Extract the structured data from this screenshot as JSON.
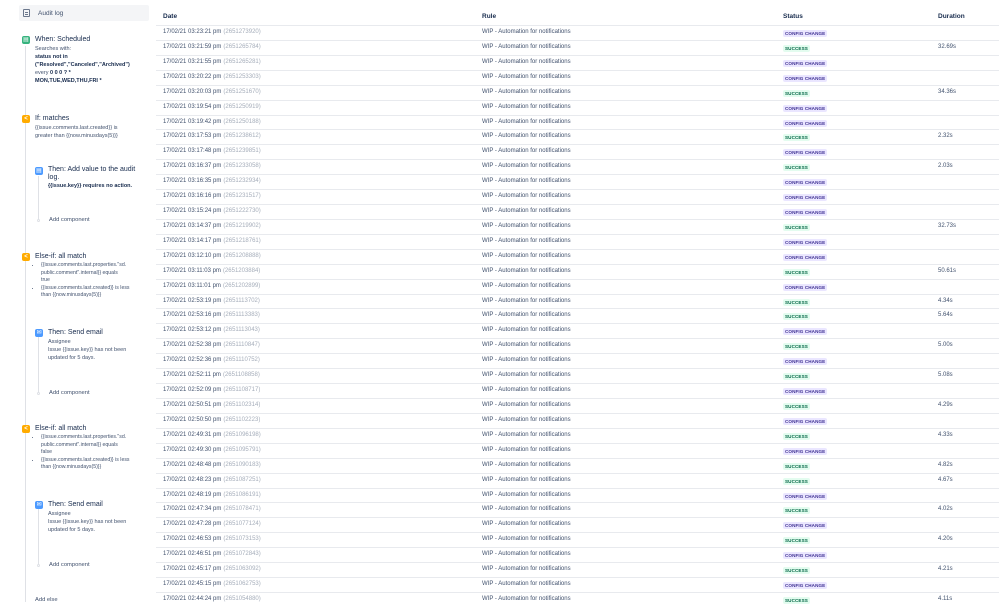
{
  "sidebar": {
    "audit_log_label": "Audit log",
    "trigger": {
      "title": "When: Scheduled",
      "line1": "Searches with:",
      "line2": "status not in",
      "line3": "(\"Resolved\",\"Canceled\",\"Archived\")",
      "line4a": "every ",
      "line4b": "0 0 0 ? *",
      "line5": "MON,TUE,WED,THU,FRI *"
    },
    "if_matches": {
      "title": "If: matches",
      "line1": "{{issue.comments.last.created}} is",
      "line2": "greater than {{now.minusdays(5)}}"
    },
    "action1": {
      "title_line1": "Then: Add value to the audit",
      "title_line2": "log.",
      "detail": "{{issue.key}} requires no action.",
      "add_component": "Add component"
    },
    "else_if_1": {
      "title": "Else-if: all match",
      "b1_l1": "{{issue.comments.last.properties.\"sd.",
      "b1_l2": "public.comment\".internal}} equals",
      "b1_l3": "true",
      "b2_l1": "{{issue.comments.last.created}} is less",
      "b2_l2": "than {{now.minusdays(5)}}"
    },
    "email1": {
      "title": "Then: Send email",
      "line1": "Assignee",
      "line2": "Issue {{issue.key}} has not been",
      "line3": "updated for 5 days.",
      "add_component": "Add component"
    },
    "else_if_2": {
      "title": "Else-if: all match",
      "b1_l1": "{{issue.comments.last.properties.\"sd.",
      "b1_l2": "public.comment\".internal}} equals",
      "b1_l3": "false",
      "b2_l1": "{{issue.comments.last.created}} is less",
      "b2_l2": "than {{now.minusdays(5)}}"
    },
    "email2": {
      "title": "Then: Send email",
      "line1": "Assignee",
      "line2": "Issue {{issue.key}} has not been",
      "line3": "updated for 5 days.",
      "add_component": "Add component"
    },
    "add_else": "Add else"
  },
  "table": {
    "headers": {
      "date": "Date",
      "rule": "Rule",
      "status": "Status",
      "duration": "Duration"
    },
    "rows": [
      {
        "date": "17/02/21 03:23:21 pm",
        "id": "(2651273920)",
        "rule": "WIP - Automation for notifications",
        "status": "CONFIG CHANGE",
        "kind": "cfg",
        "duration": ""
      },
      {
        "date": "17/02/21 03:21:59 pm",
        "id": "(2651265784)",
        "rule": "WIP - Automation for notifications",
        "status": "SUCCESS",
        "kind": "ok",
        "duration": "32.69s"
      },
      {
        "date": "17/02/21 03:21:55 pm",
        "id": "(2651265281)",
        "rule": "WIP - Automation for notifications",
        "status": "CONFIG CHANGE",
        "kind": "cfg",
        "duration": ""
      },
      {
        "date": "17/02/21 03:20:22 pm",
        "id": "(2651253303)",
        "rule": "WIP - Automation for notifications",
        "status": "CONFIG CHANGE",
        "kind": "cfg",
        "duration": ""
      },
      {
        "date": "17/02/21 03:20:03 pm",
        "id": "(2651251670)",
        "rule": "WIP - Automation for notifications",
        "status": "SUCCESS",
        "kind": "ok",
        "duration": "34.36s"
      },
      {
        "date": "17/02/21 03:19:54 pm",
        "id": "(2651250919)",
        "rule": "WIP - Automation for notifications",
        "status": "CONFIG CHANGE",
        "kind": "cfg",
        "duration": ""
      },
      {
        "date": "17/02/21 03:19:42 pm",
        "id": "(2651250188)",
        "rule": "WIP - Automation for notifications",
        "status": "CONFIG CHANGE",
        "kind": "cfg",
        "duration": ""
      },
      {
        "date": "17/02/21 03:17:53 pm",
        "id": "(2651238612)",
        "rule": "WIP - Automation for notifications",
        "status": "SUCCESS",
        "kind": "ok",
        "duration": "2.32s"
      },
      {
        "date": "17/02/21 03:17:48 pm",
        "id": "(2651239851)",
        "rule": "WIP - Automation for notifications",
        "status": "CONFIG CHANGE",
        "kind": "cfg",
        "duration": ""
      },
      {
        "date": "17/02/21 03:16:37 pm",
        "id": "(2651233058)",
        "rule": "WIP - Automation for notifications",
        "status": "SUCCESS",
        "kind": "ok",
        "duration": "2.03s"
      },
      {
        "date": "17/02/21 03:16:35 pm",
        "id": "(2651232934)",
        "rule": "WIP - Automation for notifications",
        "status": "CONFIG CHANGE",
        "kind": "cfg",
        "duration": ""
      },
      {
        "date": "17/02/21 03:16:16 pm",
        "id": "(2651231517)",
        "rule": "WIP - Automation for notifications",
        "status": "CONFIG CHANGE",
        "kind": "cfg",
        "duration": ""
      },
      {
        "date": "17/02/21 03:15:24 pm",
        "id": "(2651222730)",
        "rule": "WIP - Automation for notifications",
        "status": "CONFIG CHANGE",
        "kind": "cfg",
        "duration": ""
      },
      {
        "date": "17/02/21 03:14:37 pm",
        "id": "(2651219902)",
        "rule": "WIP - Automation for notifications",
        "status": "SUCCESS",
        "kind": "ok",
        "duration": "32.73s"
      },
      {
        "date": "17/02/21 03:14:17 pm",
        "id": "(2651218761)",
        "rule": "WIP - Automation for notifications",
        "status": "CONFIG CHANGE",
        "kind": "cfg",
        "duration": ""
      },
      {
        "date": "17/02/21 03:12:10 pm",
        "id": "(2651208888)",
        "rule": "WIP - Automation for notifications",
        "status": "CONFIG CHANGE",
        "kind": "cfg",
        "duration": ""
      },
      {
        "date": "17/02/21 03:11:03 pm",
        "id": "(2651203884)",
        "rule": "WIP - Automation for notifications",
        "status": "SUCCESS",
        "kind": "ok",
        "duration": "50.61s"
      },
      {
        "date": "17/02/21 03:11:01 pm",
        "id": "(2651202899)",
        "rule": "WIP - Automation for notifications",
        "status": "CONFIG CHANGE",
        "kind": "cfg",
        "duration": ""
      },
      {
        "date": "17/02/21 02:53:19 pm",
        "id": "(2651113702)",
        "rule": "WIP - Automation for notifications",
        "status": "SUCCESS",
        "kind": "ok",
        "duration": "4.34s"
      },
      {
        "date": "17/02/21 02:53:16 pm",
        "id": "(2651113383)",
        "rule": "WIP - Automation for notifications",
        "status": "SUCCESS",
        "kind": "ok",
        "duration": "5.64s"
      },
      {
        "date": "17/02/21 02:53:12 pm",
        "id": "(2651113043)",
        "rule": "WIP - Automation for notifications",
        "status": "CONFIG CHANGE",
        "kind": "cfg",
        "duration": ""
      },
      {
        "date": "17/02/21 02:52:38 pm",
        "id": "(2651110847)",
        "rule": "WIP - Automation for notifications",
        "status": "SUCCESS",
        "kind": "ok",
        "duration": "5.00s"
      },
      {
        "date": "17/02/21 02:52:36 pm",
        "id": "(2651110752)",
        "rule": "WIP - Automation for notifications",
        "status": "CONFIG CHANGE",
        "kind": "cfg",
        "duration": ""
      },
      {
        "date": "17/02/21 02:52:11 pm",
        "id": "(2651108858)",
        "rule": "WIP - Automation for notifications",
        "status": "SUCCESS",
        "kind": "ok",
        "duration": "5.08s"
      },
      {
        "date": "17/02/21 02:52:09 pm",
        "id": "(2651108717)",
        "rule": "WIP - Automation for notifications",
        "status": "CONFIG CHANGE",
        "kind": "cfg",
        "duration": ""
      },
      {
        "date": "17/02/21 02:50:51 pm",
        "id": "(2651102314)",
        "rule": "WIP - Automation for notifications",
        "status": "SUCCESS",
        "kind": "ok",
        "duration": "4.29s"
      },
      {
        "date": "17/02/21 02:50:50 pm",
        "id": "(2651102223)",
        "rule": "WIP - Automation for notifications",
        "status": "CONFIG CHANGE",
        "kind": "cfg",
        "duration": ""
      },
      {
        "date": "17/02/21 02:49:31 pm",
        "id": "(2651096198)",
        "rule": "WIP - Automation for notifications",
        "status": "SUCCESS",
        "kind": "ok",
        "duration": "4.33s"
      },
      {
        "date": "17/02/21 02:49:30 pm",
        "id": "(2651095791)",
        "rule": "WIP - Automation for notifications",
        "status": "CONFIG CHANGE",
        "kind": "cfg",
        "duration": ""
      },
      {
        "date": "17/02/21 02:48:48 pm",
        "id": "(2651090183)",
        "rule": "WIP - Automation for notifications",
        "status": "SUCCESS",
        "kind": "ok",
        "duration": "4.82s"
      },
      {
        "date": "17/02/21 02:48:23 pm",
        "id": "(2651087251)",
        "rule": "WIP - Automation for notifications",
        "status": "SUCCESS",
        "kind": "ok",
        "duration": "4.67s"
      },
      {
        "date": "17/02/21 02:48:19 pm",
        "id": "(2651086191)",
        "rule": "WIP - Automation for notifications",
        "status": "CONFIG CHANGE",
        "kind": "cfg",
        "duration": ""
      },
      {
        "date": "17/02/21 02:47:34 pm",
        "id": "(2651078471)",
        "rule": "WIP - Automation for notifications",
        "status": "SUCCESS",
        "kind": "ok",
        "duration": "4.02s"
      },
      {
        "date": "17/02/21 02:47:28 pm",
        "id": "(2651077124)",
        "rule": "WIP - Automation for notifications",
        "status": "CONFIG CHANGE",
        "kind": "cfg",
        "duration": ""
      },
      {
        "date": "17/02/21 02:46:53 pm",
        "id": "(2651073153)",
        "rule": "WIP - Automation for notifications",
        "status": "SUCCESS",
        "kind": "ok",
        "duration": "4.20s"
      },
      {
        "date": "17/02/21 02:46:51 pm",
        "id": "(2651072843)",
        "rule": "WIP - Automation for notifications",
        "status": "CONFIG CHANGE",
        "kind": "cfg",
        "duration": ""
      },
      {
        "date": "17/02/21 02:45:17 pm",
        "id": "(2651063092)",
        "rule": "WIP - Automation for notifications",
        "status": "SUCCESS",
        "kind": "ok",
        "duration": "4.21s"
      },
      {
        "date": "17/02/21 02:45:15 pm",
        "id": "(2651062753)",
        "rule": "WIP - Automation for notifications",
        "status": "CONFIG CHANGE",
        "kind": "cfg",
        "duration": ""
      },
      {
        "date": "17/02/21 02:44:24 pm",
        "id": "(2651054880)",
        "rule": "WIP - Automation for notifications",
        "status": "SUCCESS",
        "kind": "ok",
        "duration": "4.11s"
      }
    ]
  }
}
